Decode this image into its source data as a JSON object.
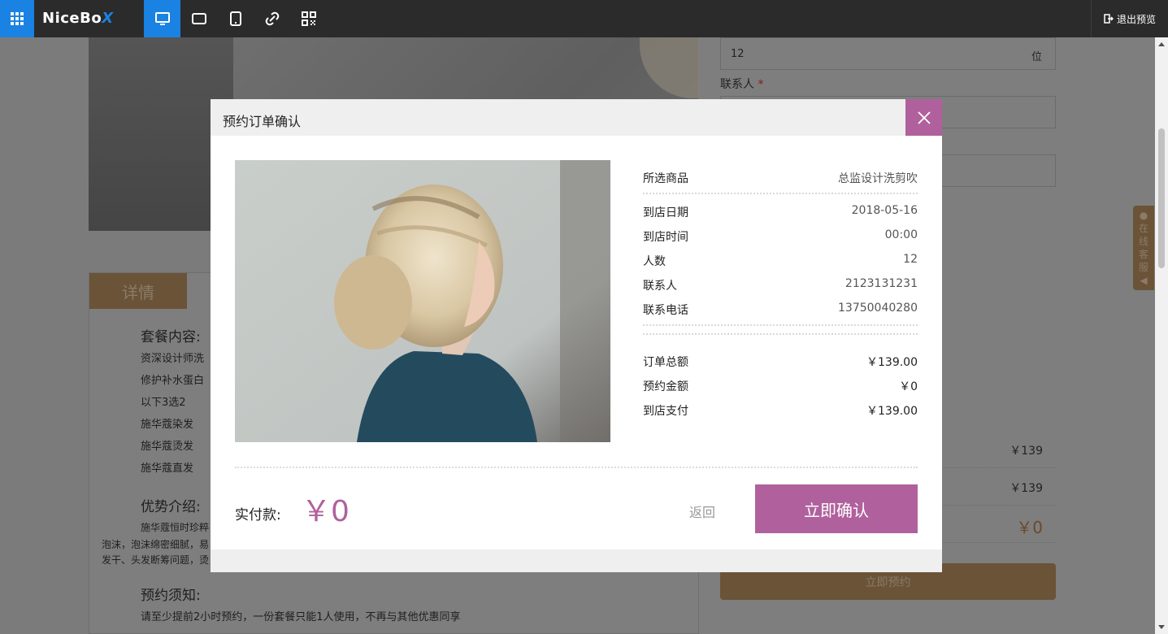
{
  "toolbar": {
    "logo_main": "NiceBo",
    "logo_accent": "X",
    "exit_label": "退出预览",
    "tools": [
      "desktop-icon",
      "tablet-landscape-icon",
      "tablet-portrait-icon",
      "link-icon",
      "qrcode-icon"
    ]
  },
  "background": {
    "people_value": "12",
    "people_unit": "位",
    "contact_label": "联系人",
    "required_mark": "*",
    "prices": [
      "￥139",
      "￥139",
      "￥0"
    ],
    "book_button": "立即预约",
    "detail_tab": "详情",
    "package_title": "套餐内容:",
    "package_items": [
      "资深设计师洗",
      "修护补水蛋白",
      "以下3选2",
      "施华蔻染发",
      "施华蔻烫发",
      "施华蔻直发"
    ],
    "advantage_title": "优势介绍:",
    "advantage_lines": [
      "施华蔻恒时珍粹",
      "泡沫，泡沫绵密细腻，易",
      "发干、头发断筹问题，烫"
    ],
    "notice_title": "预约须知:",
    "notice_text": "请至少提前2小时预约，一份套餐只能1人使用，不再与其他优惠同享",
    "service_chars": [
      "在",
      "线",
      "客",
      "服"
    ]
  },
  "modal": {
    "title": "预约订单确认",
    "product_label": "所选商品",
    "product_value": "总监设计洗剪吹",
    "details": [
      {
        "label": "到店日期",
        "value": "2018-05-16"
      },
      {
        "label": "到店时间",
        "value": "00:00"
      },
      {
        "label": "人数",
        "value": "12"
      },
      {
        "label": "联系人",
        "value": "2123131231"
      },
      {
        "label": "联系电话",
        "value": "13750040280"
      }
    ],
    "amounts": [
      {
        "label": "订单总额",
        "value": "￥139.00"
      },
      {
        "label": "预约金额",
        "value": "￥0"
      },
      {
        "label": "到店支付",
        "value": "￥139.00"
      }
    ],
    "pay_label": "实付款:",
    "pay_amount": "￥0",
    "back_label": "返回",
    "confirm_label": "立即确认"
  },
  "colors": {
    "accent": "#b0619d",
    "toolbar": "#2b2b2b",
    "toolbar_active": "#1a82e2",
    "brown": "#8c6c46"
  }
}
